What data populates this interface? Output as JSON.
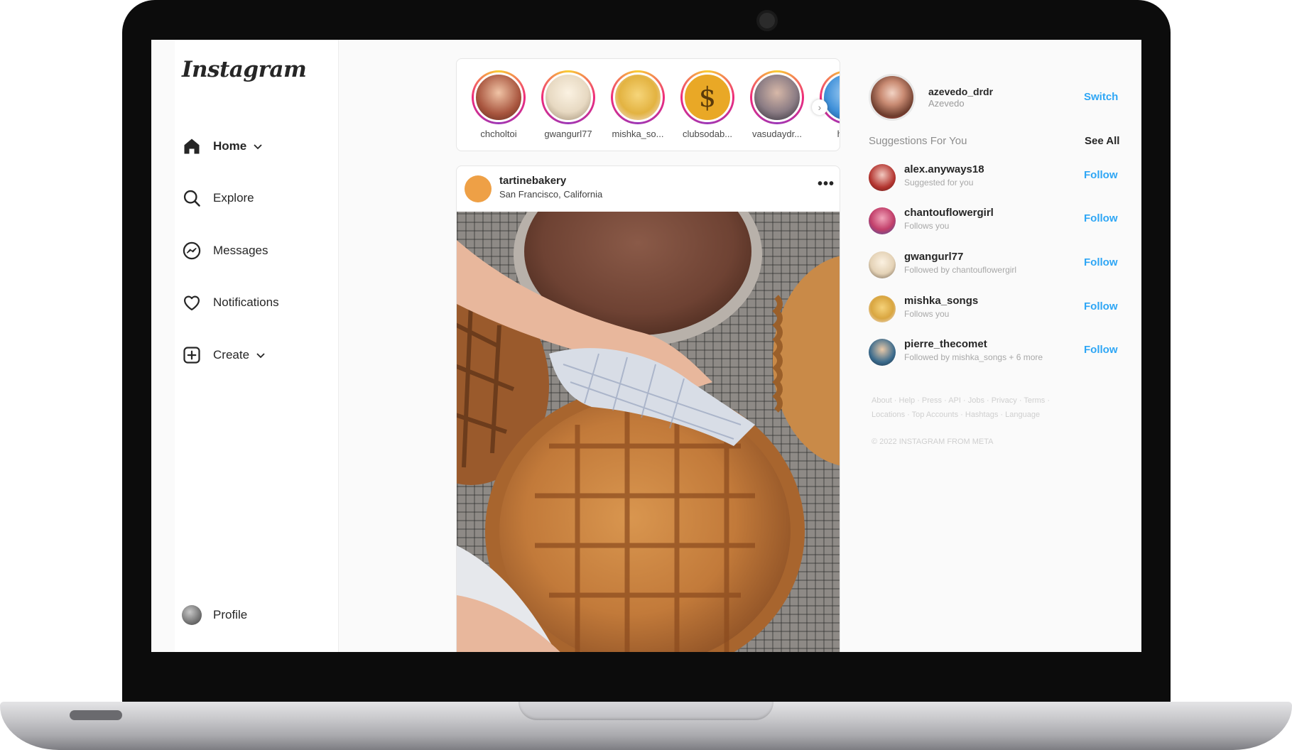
{
  "app": {
    "logo_text": "Instagram"
  },
  "sidebar": {
    "items": [
      {
        "label": "Home",
        "icon": "home-icon",
        "active": true,
        "has_chevron": true
      },
      {
        "label": "Explore",
        "icon": "search-icon"
      },
      {
        "label": "Messages",
        "icon": "messenger-icon"
      },
      {
        "label": "Notifications",
        "icon": "heart-icon"
      },
      {
        "label": "Create",
        "icon": "plus-square-icon",
        "has_chevron": true
      }
    ],
    "profile": {
      "label": "Profile"
    }
  },
  "stories": [
    {
      "username": "chcholtoi",
      "color": "#a8553e"
    },
    {
      "username": "gwangurl77",
      "color": "#e7d9c2"
    },
    {
      "username": "mishka_so...",
      "color": "#e3b341"
    },
    {
      "username": "clubsodab...",
      "color": "#e9a826"
    },
    {
      "username": "vasudaydr...",
      "color": "#8b7c84"
    },
    {
      "username": "hi_ki",
      "color": "#3e8fd8"
    }
  ],
  "post": {
    "username": "tartinebakery",
    "location": "San Francisco, California",
    "more": "•••",
    "avatar_color": "#eea046"
  },
  "current_user": {
    "username": "azevedo_drdr",
    "name": "Azevedo",
    "switch_label": "Switch"
  },
  "suggestions": {
    "title": "Suggestions For You",
    "see_all": "See All",
    "items": [
      {
        "username": "alex.anyways18",
        "subtitle": "Suggested for you",
        "action": "Follow",
        "color": "#b3342f"
      },
      {
        "username": "chantouflowergirl",
        "subtitle": "Follows you",
        "action": "Follow",
        "color": "#c23f6a"
      },
      {
        "username": "gwangurl77",
        "subtitle": "Followed by chantouflowergirl",
        "action": "Follow",
        "color": "#e4d2b6"
      },
      {
        "username": "mishka_songs",
        "subtitle": "Follows you",
        "action": "Follow",
        "color": "#d9a640"
      },
      {
        "username": "pierre_thecomet",
        "subtitle": "Followed by mishka_songs + 6 more",
        "action": "Follow",
        "color": "#3a6a8c"
      }
    ]
  },
  "footer": {
    "links": "About · Help · Press · API · Jobs · Privacy · Terms · Locations · Top Accounts · Hashtags · Language",
    "copyright": "© 2022 INSTAGRAM FROM META"
  },
  "colors": {
    "accent": "#2ea6f5",
    "text": "#262626",
    "muted": "#8e8e8e"
  }
}
